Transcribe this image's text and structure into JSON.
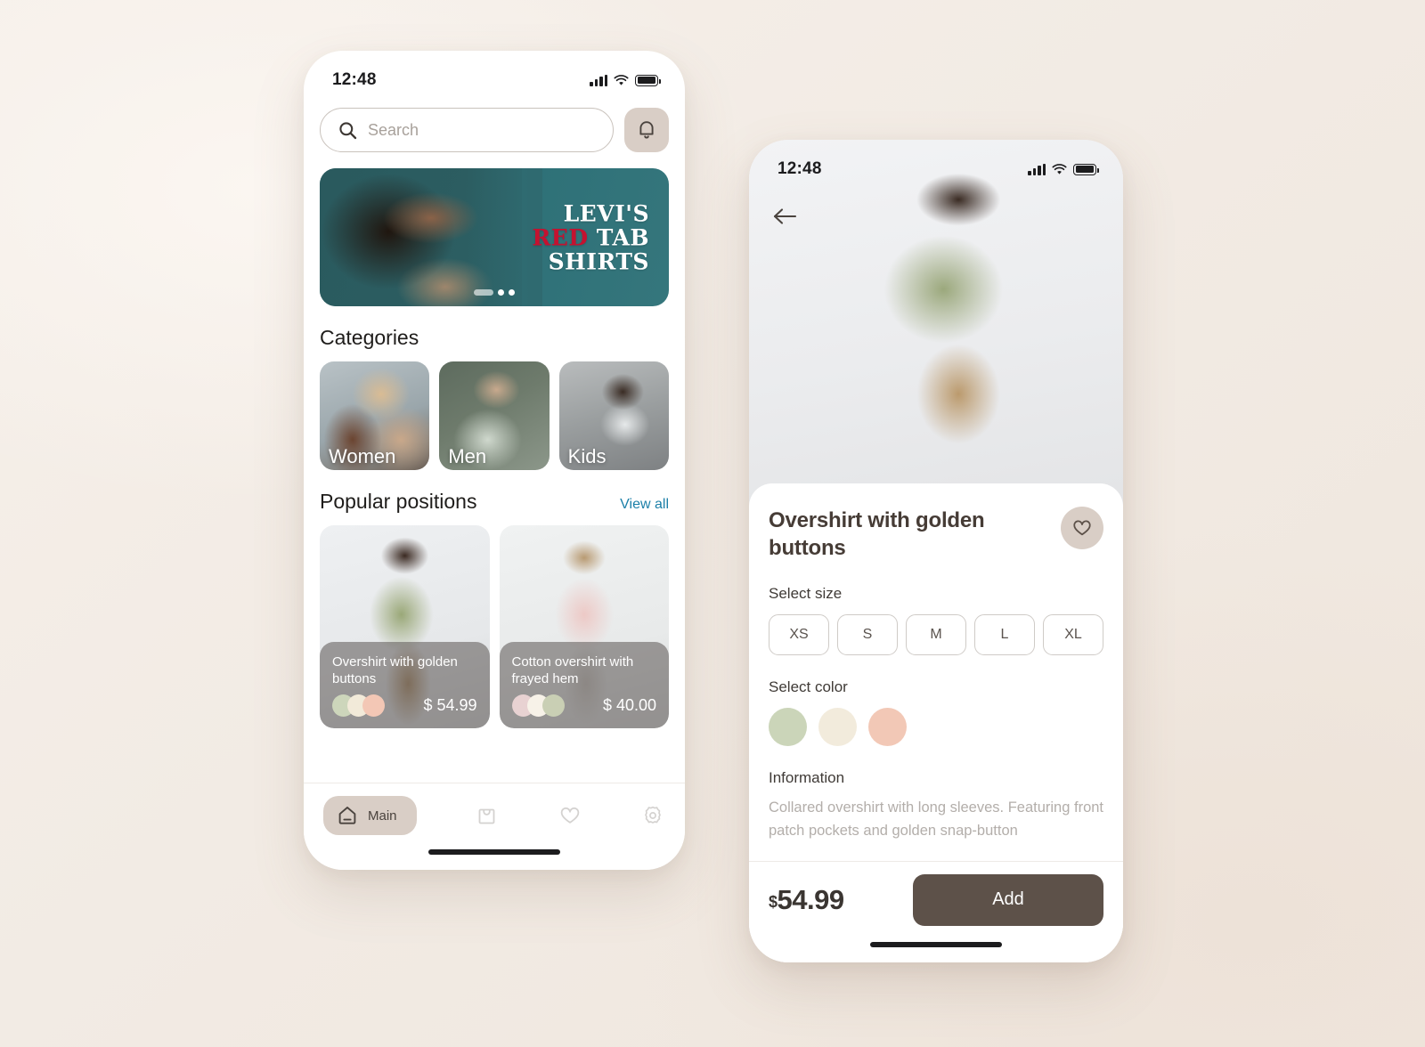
{
  "home": {
    "status": {
      "time": "12:48"
    },
    "search": {
      "placeholder": "Search",
      "value": ""
    },
    "bell_icon": "bell-icon",
    "banner": {
      "line1": "LEVI'S",
      "line2_red": "RED",
      "line2_rest": "TAB",
      "line3": "SHIRTS",
      "dots_total": 3,
      "dots_active_index": 0
    },
    "categories": {
      "title": "Categories",
      "items": [
        {
          "label": "Women"
        },
        {
          "label": "Men"
        },
        {
          "label": "Kids"
        }
      ]
    },
    "popular": {
      "title": "Popular positions",
      "view_all": "View all",
      "items": [
        {
          "name": "Overshirt with golden buttons",
          "price": "$ 54.99",
          "swatches": [
            "#cdd6bb",
            "#f2ead9",
            "#f3c7b5"
          ]
        },
        {
          "name": "Cotton overshirt with frayed hem",
          "price": "$ 40.00",
          "swatches": [
            "#e8d2d2",
            "#f7f2e8",
            "#c9cfb4"
          ]
        }
      ]
    },
    "nav": {
      "items": [
        {
          "label": "Main",
          "icon": "home-icon",
          "active": true
        },
        {
          "label": "",
          "icon": "bag-icon",
          "active": false
        },
        {
          "label": "",
          "icon": "heart-icon",
          "active": false
        },
        {
          "label": "",
          "icon": "gear-icon",
          "active": false
        }
      ]
    }
  },
  "detail": {
    "status": {
      "time": "12:48"
    },
    "back_icon": "arrow-left-icon",
    "title": "Overshirt with golden buttons",
    "favorite_icon": "heart-icon",
    "size": {
      "label": "Select size",
      "options": [
        "XS",
        "S",
        "M",
        "L",
        "XL"
      ]
    },
    "color": {
      "label": "Select color",
      "options": [
        "#cbd5b9",
        "#f2ebdc",
        "#f2c8b6"
      ]
    },
    "information": {
      "label": "Information",
      "text": "Collared overshirt with long sleeves. Featuring front patch pockets and golden snap-button"
    },
    "footer": {
      "currency": "$",
      "price": "54.99",
      "add_label": "Add"
    }
  },
  "theme": {
    "page_bg": "#f3ece6",
    "accent_link": "#1b7fa8",
    "beige": "#d9cec6",
    "brown": "#5d5149",
    "banner_teal": "#2f6a70",
    "banner_red": "#c41230"
  }
}
